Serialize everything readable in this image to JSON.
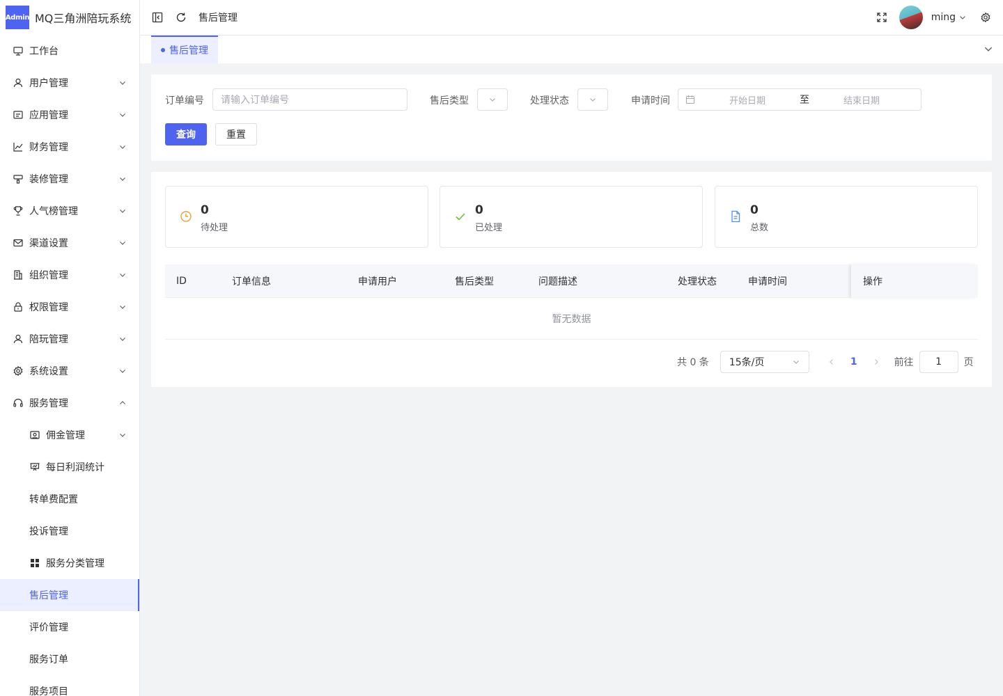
{
  "brand": {
    "logo_text": "Admin",
    "title": "MQ三角洲陪玩系统"
  },
  "sidebar": {
    "items": [
      {
        "label": "工作台",
        "icon": "monitor-icon",
        "arrow": false
      },
      {
        "label": "用户管理",
        "icon": "user-icon",
        "arrow": "down"
      },
      {
        "label": "应用管理",
        "icon": "app-icon",
        "arrow": "down"
      },
      {
        "label": "财务管理",
        "icon": "chart-icon",
        "arrow": "down"
      },
      {
        "label": "装修管理",
        "icon": "brush-icon",
        "arrow": "down"
      },
      {
        "label": "人气榜管理",
        "icon": "trophy-icon",
        "arrow": "down"
      },
      {
        "label": "渠道设置",
        "icon": "mail-icon",
        "arrow": "down"
      },
      {
        "label": "组织管理",
        "icon": "building-icon",
        "arrow": "down"
      },
      {
        "label": "权限管理",
        "icon": "lock-icon",
        "arrow": "down"
      },
      {
        "label": "陪玩管理",
        "icon": "user-icon",
        "arrow": "down"
      },
      {
        "label": "系统设置",
        "icon": "gear-icon",
        "arrow": "down"
      },
      {
        "label": "服务管理",
        "icon": "headset-icon",
        "arrow": "up"
      }
    ],
    "sub_items": [
      {
        "label": "佣金管理",
        "icon": "wallet-icon",
        "arrow": "down"
      },
      {
        "label": "每日利润统计",
        "icon": "presentation-icon",
        "arrow": false
      },
      {
        "label": "转单费配置",
        "icon": "",
        "arrow": false
      },
      {
        "label": "投诉管理",
        "icon": "",
        "arrow": false
      },
      {
        "label": "服务分类管理",
        "icon": "grid-icon",
        "arrow": false
      },
      {
        "label": "售后管理",
        "icon": "",
        "arrow": false,
        "active": true
      },
      {
        "label": "评价管理",
        "icon": "",
        "arrow": false
      },
      {
        "label": "服务订单",
        "icon": "",
        "arrow": false
      },
      {
        "label": "服务项目",
        "icon": "",
        "arrow": false
      }
    ]
  },
  "header": {
    "breadcrumb": "售后管理",
    "username": "ming"
  },
  "tabs": [
    {
      "label": "售后管理"
    }
  ],
  "search": {
    "order_no_label": "订单编号",
    "order_no_placeholder": "请输入订单编号",
    "type_label": "售后类型",
    "status_label": "处理状态",
    "time_label": "申请时间",
    "start_placeholder": "开始日期",
    "range_sep": "至",
    "end_placeholder": "结束日期",
    "query_button": "查询",
    "reset_button": "重置"
  },
  "stats": [
    {
      "value": "0",
      "label": "待处理",
      "icon": "clock-icon",
      "color": "#e6a23c"
    },
    {
      "value": "0",
      "label": "已处理",
      "icon": "check-icon",
      "color": "#67c23a"
    },
    {
      "value": "0",
      "label": "总数",
      "icon": "document-icon",
      "color": "#4e8ef0"
    }
  ],
  "table": {
    "columns": [
      "ID",
      "订单信息",
      "申请用户",
      "售后类型",
      "问题描述",
      "处理状态",
      "申请时间",
      "操作"
    ],
    "empty_text": "暂无数据"
  },
  "pagination": {
    "total_text": "共 0 条",
    "page_size": "15条/页",
    "current_page": "1",
    "goto_label": "前往",
    "goto_value": "1",
    "page_unit": "页"
  },
  "colors": {
    "accent": "#4e63f0",
    "active_bg": "#ecefff"
  }
}
